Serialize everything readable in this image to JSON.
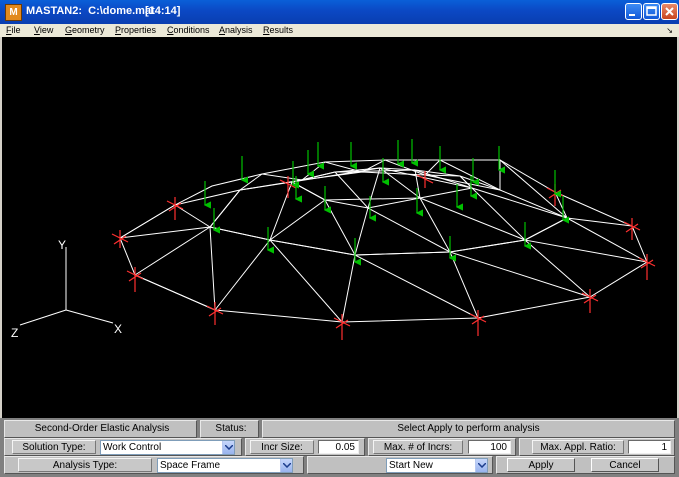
{
  "window": {
    "title": "MASTAN2:  C:\\dome.mat",
    "time": "[14:14]",
    "icon_name": "matlab-icon",
    "minimize": "minimize-icon",
    "maximize": "maximize-icon",
    "close": "close-icon"
  },
  "menu": {
    "items": [
      "File",
      "View",
      "Geometry",
      "Properties",
      "Conditions",
      "Analysis",
      "Results"
    ]
  },
  "axes": {
    "x": "X",
    "y": "Y",
    "z": "Z"
  },
  "panel": {
    "analysis_name": "Second-Order Elastic Analysis",
    "status_label": "Status:",
    "status_value": "Select Apply to perform analysis",
    "solution_type_label": "Solution Type:",
    "solution_type_value": "Work Control",
    "incr_size_label": "Incr Size:",
    "incr_size_value": "0.05",
    "max_incrs_label": "Max. # of Incrs:",
    "max_incrs_value": "100",
    "max_ratio_label": "Max. Appl. Ratio:",
    "max_ratio_value": "1",
    "analysis_type_label": "Analysis Type:",
    "analysis_type_value": "Space Frame",
    "start_value": "Start New",
    "apply_label": "Apply",
    "cancel_label": "Cancel"
  },
  "colors": {
    "load_arrow": "#00c000",
    "support": "#ff3030",
    "member": "#ffffff",
    "background": "#000000"
  }
}
